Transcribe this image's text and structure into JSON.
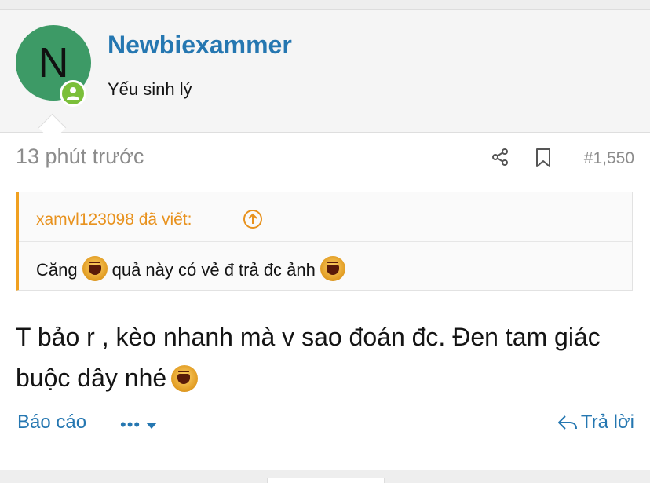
{
  "user": {
    "avatar_letter": "N",
    "name": "Newbiexammer",
    "title": "Yếu sinh lý"
  },
  "post": {
    "timestamp": "13 phút trước",
    "number": "#1,550",
    "quote": {
      "author": "xamvl123098 đã viết:",
      "text_part1": "Căng",
      "text_part2": "quả này có vẻ đ trả đc ảnh"
    },
    "body": "T bảo r , kèo nhanh mà v sao đoán đc. Đen tam giác buộc dây nhé"
  },
  "actions": {
    "report": "Báo cáo",
    "more": "•••",
    "reply": "Trả lời"
  },
  "colors": {
    "link": "#2577b1",
    "quote_accent": "#f0a020",
    "avatar_bg": "#3d9a66",
    "online": "#7bbf3a"
  },
  "icons": [
    "share-icon",
    "bookmark-icon",
    "arrow-up-circle-icon",
    "reply-icon",
    "caret-down-icon",
    "user-icon",
    "laughing-emoji-icon"
  ]
}
